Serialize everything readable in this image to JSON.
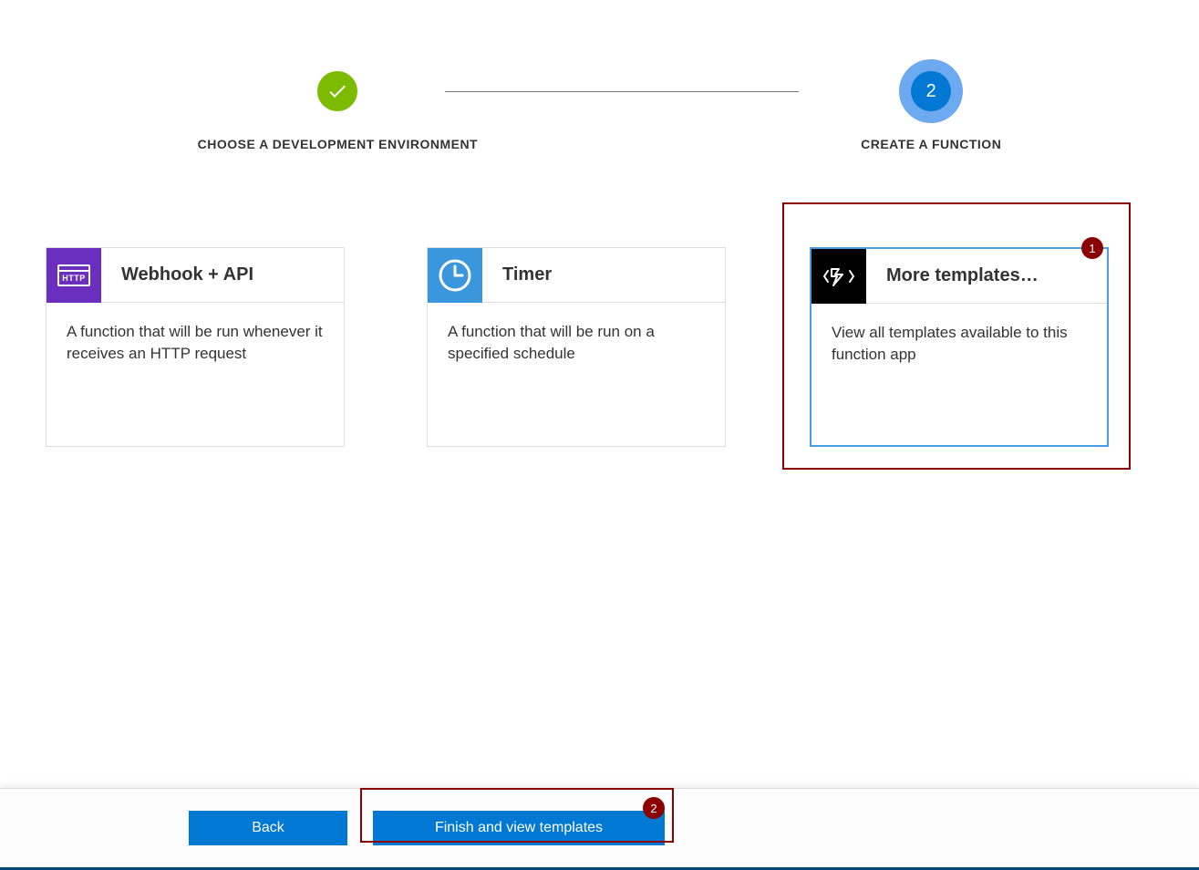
{
  "stepper": {
    "step1": {
      "label": "CHOOSE A DEVELOPMENT ENVIRONMENT"
    },
    "step2": {
      "label": "CREATE A FUNCTION",
      "number": "2"
    }
  },
  "cards": [
    {
      "title": "Webhook + API",
      "desc": "A function that will be run whenever it receives an HTTP request",
      "icon": "http-icon",
      "iconLabel": "HTTP"
    },
    {
      "title": "Timer",
      "desc": "A function that will be run on a specified schedule",
      "icon": "clock-icon"
    },
    {
      "title": "More templates…",
      "desc": "View all templates available to this function app",
      "icon": "bolt-icon"
    }
  ],
  "buttons": {
    "back": "Back",
    "finish": "Finish and view templates"
  },
  "annotations": {
    "badge1": "1",
    "badge2": "2"
  }
}
